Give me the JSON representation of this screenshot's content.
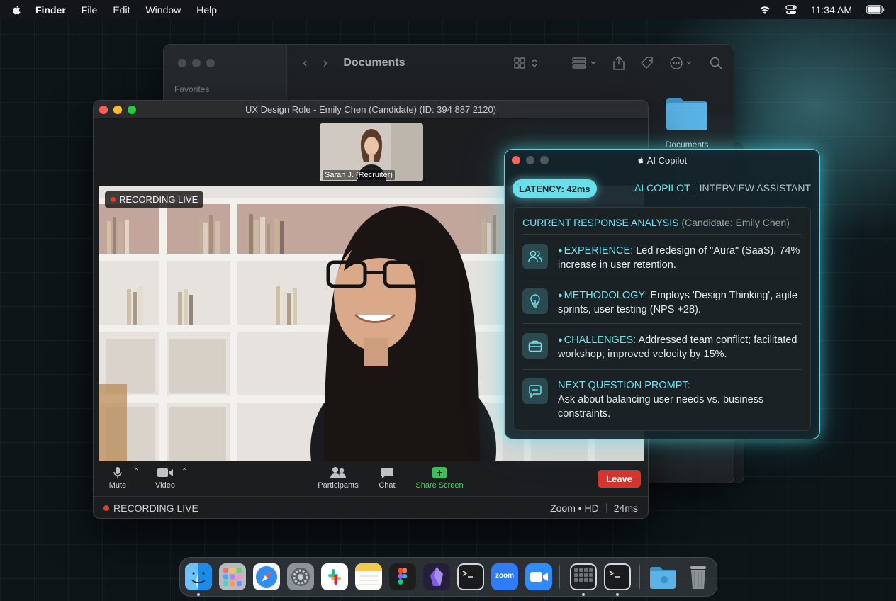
{
  "menubar": {
    "app_name": "Finder",
    "items": [
      "File",
      "Edit",
      "Window",
      "Help"
    ],
    "time": "11:34 AM"
  },
  "finder": {
    "title": "Documents",
    "sidebar_section": "Favorites",
    "folder_label": "Documents"
  },
  "zoom": {
    "window_title": "UX Design Role - Emily Chen (Candidate) (ID: 394 887 2120)",
    "thumbnail_name": "Sarah J. (Recruiter)",
    "recording_badge": "RECORDING LIVE",
    "controls": {
      "mute": "Mute",
      "video": "Video",
      "participants": "Participants",
      "chat": "Chat",
      "share": "Share Screen",
      "leave": "Leave"
    },
    "status": {
      "recording": "RECORDING LIVE",
      "quality": "Zoom • HD",
      "latency": "24ms"
    }
  },
  "copilot": {
    "title": "AI Copilot",
    "latency_badge": "LATENCY: 42ms",
    "header_primary": "AI COPILOT",
    "header_secondary": "INTERVIEW ASSISTANT",
    "analysis_title": "CURRENT RESPONSE ANALYSIS",
    "analysis_subtitle": "(Candidate: Emily Chen)",
    "items": [
      {
        "icon": "users-icon",
        "label": "EXPERIENCE:",
        "text": "Led redesign of \"Aura\" (SaaS). 74% increase in user retention."
      },
      {
        "icon": "lightbulb-icon",
        "label": "METHODOLOGY:",
        "text": "Employs 'Design Thinking', agile sprints, user testing (NPS +28)."
      },
      {
        "icon": "briefcase-icon",
        "label": "CHALLENGES:",
        "text": "Addressed team conflict; facilitated workshop; improved velocity by 15%."
      },
      {
        "icon": "chat-bubble-icon",
        "label": "NEXT QUESTION PROMPT:",
        "text": "Ask about balancing user needs vs. business constraints."
      }
    ]
  },
  "colors": {
    "accent_cyan": "#72e2ee",
    "recording_red": "#e23b35",
    "leave_red": "#d6352d",
    "share_green": "#4cd264"
  },
  "dock": {
    "apps": [
      "finder-icon",
      "launchpad-icon",
      "safari-icon",
      "system-settings-icon",
      "slack-icon",
      "notes-icon",
      "figma-icon",
      "obsidian-icon",
      "terminal-icon",
      "zoom-app-icon",
      "zoom-video-icon",
      "screen-grid-icon",
      "terminal-icon",
      "folder-icon",
      "trash-icon"
    ],
    "zoom_label": "zoom"
  }
}
